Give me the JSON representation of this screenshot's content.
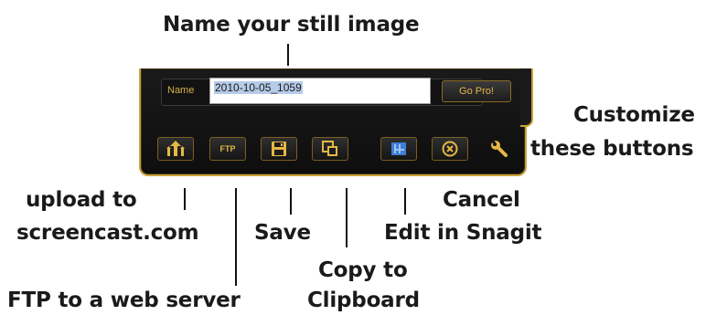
{
  "callouts": {
    "name": "Name your still image",
    "customize_line1": "Customize",
    "customize_line2": "these buttons",
    "upload_line1": "upload to",
    "upload_line2": "screencast.com",
    "ftp": "FTP to a web server",
    "save": "Save",
    "copy_line1": "Copy to",
    "copy_line2": "Clipboard",
    "cancel": "Cancel",
    "edit": "Edit in Snagit"
  },
  "toolbar": {
    "name_label": "Name",
    "name_value": "2010-10-05_1059",
    "gopro_label": "Go Pro!",
    "ftp_label": "FTP"
  },
  "icons": {
    "upload": "upload-icon",
    "ftp": "ftp-icon",
    "save": "floppy-disk-icon",
    "copy": "copy-icon",
    "edit": "snagit-editor-icon",
    "cancel": "cancel-circle-x-icon",
    "customize": "wrench-icon"
  },
  "colors": {
    "accent": "#c9a33a",
    "icon_gold": "#e4b843",
    "icon_blue": "#3d7fd6",
    "panel": "#141414"
  }
}
